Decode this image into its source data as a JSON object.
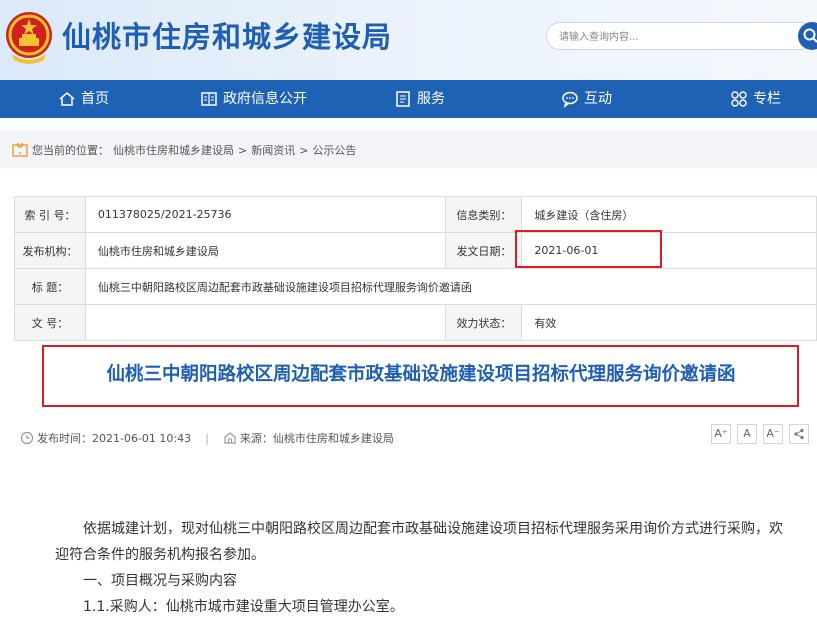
{
  "header": {
    "site_title": "仙桃市住房和城乡建设局",
    "search_placeholder": "请输入查询内容..."
  },
  "nav": [
    {
      "label": "首页",
      "icon": "home-icon"
    },
    {
      "label": "政府信息公开",
      "icon": "newspaper-icon"
    },
    {
      "label": "服务",
      "icon": "document-icon"
    },
    {
      "label": "互动",
      "icon": "chat-icon"
    },
    {
      "label": "专栏",
      "icon": "grid-icon"
    }
  ],
  "breadcrumb": {
    "prefix": "您当前的位置：",
    "items": [
      "仙桃市住房和城乡建设局",
      "新闻资讯",
      "公示公告"
    ],
    "separator": " > "
  },
  "meta": {
    "index_label": "索 引 号：",
    "index_value": "011378025/2021-25736",
    "category_label": "信息类别：",
    "category_value": "城乡建设（含住房）",
    "publisher_label": "发布机构：",
    "publisher_value": "仙桃市住房和城乡建设局",
    "date_label": "发文日期：",
    "date_value": "2021-06-01",
    "title_label": "标  题：",
    "title_value": "仙桃三中朝阳路校区周边配套市政基础设施建设项目招标代理服务询价邀请函",
    "doc_no_label": "文  号：",
    "doc_no_value": "",
    "status_label": "效力状态：",
    "status_value": "有效"
  },
  "article": {
    "title": "仙桃三中朝阳路校区周边配套市政基础设施建设项目招标代理服务询价邀请函",
    "publish_time": "发布时间：2021-06-01 10:43",
    "source": "来源：仙桃市住房和城乡建设局",
    "tools": [
      "A⁺",
      "A",
      "A⁻",
      "share"
    ],
    "paragraphs": [
      "依据城建计划，现对仙桃三中朝阳路校区周边配套市政基础设施建设项目招标代理服务采用询价方式进行采购，欢迎符合条件的服务机构报名参加。",
      "一、项目概况与采购内容",
      "1.1.采购人：仙桃市城市建设重大项目管理办公室。"
    ]
  },
  "colors": {
    "brand_blue": "#1e62b5",
    "title_blue": "#1f5fb3",
    "highlight_red": "#e11b22"
  }
}
